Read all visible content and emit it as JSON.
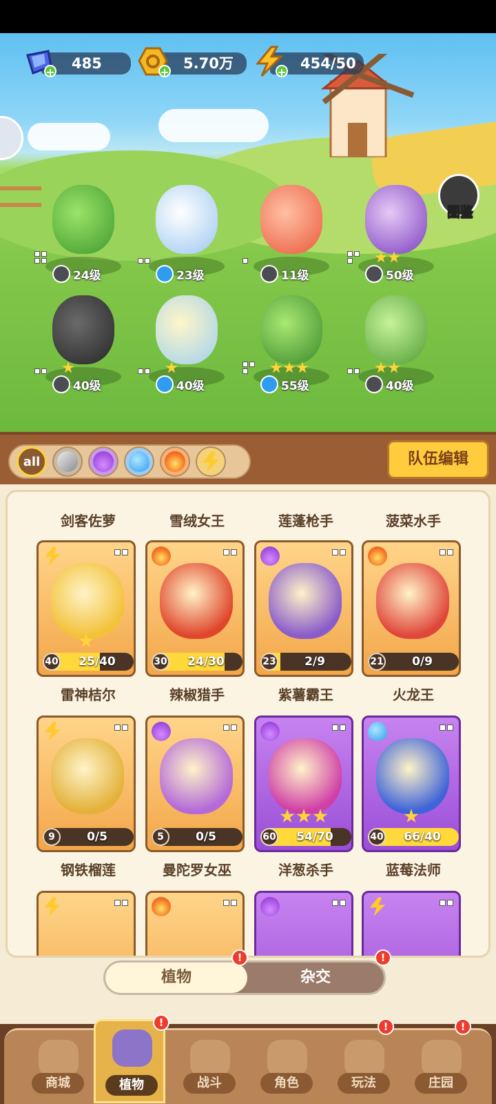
{
  "resources": {
    "gems": "485",
    "gold": "5.70万",
    "energy": "454/50"
  },
  "scene": {
    "atlas_label": "图鉴",
    "lineup": [
      {
        "level": "24级",
        "element": "sword"
      },
      {
        "level": "23级",
        "element": "water"
      },
      {
        "level": "11级",
        "element": "sword"
      },
      {
        "level": "50级",
        "element": "sword"
      },
      {
        "level": "40级",
        "element": "sword"
      },
      {
        "level": "40级",
        "element": "water"
      },
      {
        "level": "55级",
        "element": "water"
      },
      {
        "level": "40级",
        "element": "sword"
      }
    ]
  },
  "filters": {
    "all_label": "all",
    "team_edit_label": "队伍编辑"
  },
  "collection": {
    "top_row_names": [
      "剑客佐萝",
      "雪绒女王",
      "莲蓬枪手",
      "菠菜水手"
    ],
    "cards": [
      {
        "name": "雷神桔尔",
        "level": "40",
        "progress": "25/40",
        "fill": 0.625,
        "element": "bolt",
        "rarity": "orange",
        "stars": 1
      },
      {
        "name": "辣椒猎手",
        "level": "30",
        "progress": "24/30",
        "fill": 0.8,
        "element": "fire",
        "rarity": "orange",
        "stars": 0
      },
      {
        "name": "紫薯霸王",
        "level": "23",
        "progress": "2/9",
        "fill": 0.22,
        "element": "potion",
        "rarity": "orange",
        "stars": 0
      },
      {
        "name": "火龙王",
        "level": "21",
        "progress": "0/9",
        "fill": 0,
        "element": "fire",
        "rarity": "orange",
        "stars": 0
      },
      {
        "name": "钢铁榴莲",
        "level": "9",
        "progress": "0/5",
        "fill": 0,
        "element": "bolt",
        "rarity": "orange",
        "stars": 0
      },
      {
        "name": "曼陀罗女巫",
        "level": "5",
        "progress": "0/5",
        "fill": 0,
        "element": "potion",
        "rarity": "orange",
        "stars": 0
      },
      {
        "name": "洋葱杀手",
        "level": "60",
        "progress": "54/70",
        "fill": 0.77,
        "element": "potion",
        "rarity": "purple",
        "stars": 3
      },
      {
        "name": "蓝莓法师",
        "level": "40",
        "progress": "66/40",
        "fill": 1,
        "element": "water",
        "rarity": "purple",
        "stars": 1
      }
    ]
  },
  "tabs": {
    "plants": "植物",
    "hybrid": "杂交",
    "badge": "!"
  },
  "nav": {
    "items": [
      "商城",
      "植物",
      "战斗",
      "角色",
      "玩法",
      "庄园"
    ],
    "active": "植物"
  }
}
